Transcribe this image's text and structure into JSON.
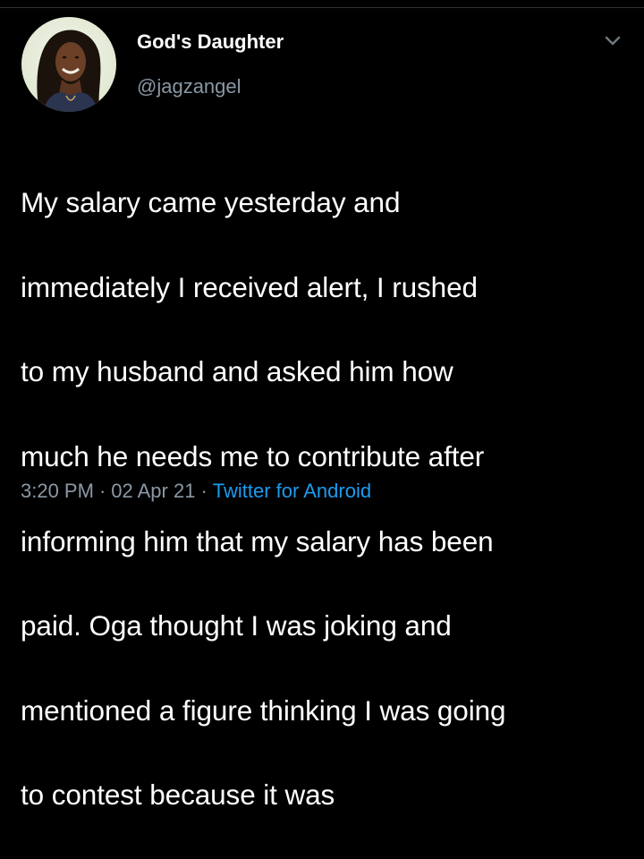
{
  "tweet": {
    "display_name": "God's Daughter",
    "handle": "@jagzangel",
    "text_lines": [
      "My salary came yesterday and",
      "immediately I received alert, I rushed",
      "to my husband and asked him how",
      "much he needs me to contribute after",
      "informing him that my salary has been",
      "paid. Oga thought I was joking and",
      "mentioned a figure thinking I was going",
      "to contest because it was"
    ],
    "time": "3:20 PM",
    "separator": "·",
    "date": "02 Apr 21",
    "source": "Twitter for Android"
  },
  "icons": {
    "avatar": "profile-photo",
    "caret": "chevron-down-icon"
  },
  "colors": {
    "background": "#000000",
    "text": "#ffffff",
    "secondary": "#8b98a5",
    "link": "#1d9bf0"
  }
}
